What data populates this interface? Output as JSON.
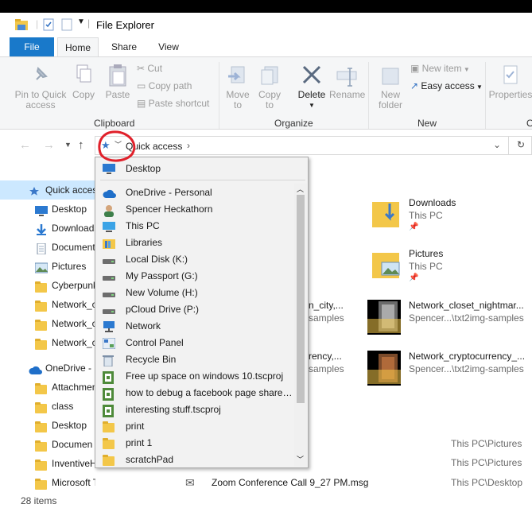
{
  "window": {
    "title": "File Explorer"
  },
  "tabs": [
    {
      "label": "File"
    },
    {
      "label": "Home"
    },
    {
      "label": "Share"
    },
    {
      "label": "View"
    }
  ],
  "ribbon": {
    "pin_quick_access": "Pin to Quick\naccess",
    "copy": "Copy",
    "paste": "Paste",
    "cut": "Cut",
    "copy_path": "Copy path",
    "paste_shortcut": "Paste shortcut",
    "clipboard_group": "Clipboard",
    "move_to": "Move\nto",
    "copy_to": "Copy\nto",
    "delete": "Delete",
    "rename": "Rename",
    "organize_group": "Organize",
    "new_folder": "New\nfolder",
    "new_item": "New item",
    "easy_access": "Easy access",
    "new_group": "New",
    "properties": "Properties",
    "open_group": "O"
  },
  "address": {
    "breadcrumb": "Quick access"
  },
  "nav_pane": [
    {
      "label": "Quick access",
      "icon": "star-icon"
    },
    {
      "label": "Desktop",
      "icon": "desktop-icon"
    },
    {
      "label": "Downloads",
      "icon": "download-icon"
    },
    {
      "label": "Documents",
      "icon": "documents-icon"
    },
    {
      "label": "Pictures",
      "icon": "pictures-icon"
    },
    {
      "label": "Cyberpunk",
      "icon": "folder-icon"
    },
    {
      "label": "Network_c",
      "icon": "folder-icon"
    },
    {
      "label": "Network_c",
      "icon": "folder-icon"
    },
    {
      "label": "Network_c",
      "icon": "folder-icon"
    },
    {
      "label": "OneDrive - I",
      "icon": "cloud-icon"
    },
    {
      "label": "Attachmen",
      "icon": "folder-icon"
    },
    {
      "label": "class",
      "icon": "folder-icon"
    },
    {
      "label": "Desktop",
      "icon": "folder-icon"
    },
    {
      "label": "Documen",
      "icon": "folder-icon"
    },
    {
      "label": "InventiveH",
      "icon": "folder-icon"
    },
    {
      "label": "Microsoft Teams Chat",
      "icon": "folder-icon"
    }
  ],
  "dropdown": {
    "top_item": "Desktop",
    "items": [
      {
        "label": "OneDrive - Personal",
        "icon": "cloud-icon"
      },
      {
        "label": "Spencer Heckathorn",
        "icon": "user-icon"
      },
      {
        "label": "This PC",
        "icon": "pc-icon"
      },
      {
        "label": "Libraries",
        "icon": "library-icon"
      },
      {
        "label": "Local Disk (K:)",
        "icon": "drive-icon"
      },
      {
        "label": "My Passport (G:)",
        "icon": "drive-icon"
      },
      {
        "label": "New Volume (H:)",
        "icon": "drive-icon"
      },
      {
        "label": "pCloud Drive (P:)",
        "icon": "drive-icon"
      },
      {
        "label": "Network",
        "icon": "network-icon"
      },
      {
        "label": "Control Panel",
        "icon": "control-panel-icon"
      },
      {
        "label": "Recycle Bin",
        "icon": "recycle-bin-icon"
      },
      {
        "label": "Free up space on windows 10.tscproj",
        "icon": "tscproj-icon"
      },
      {
        "label": "how to debug a facebook page share....",
        "icon": "tscproj-icon"
      },
      {
        "label": "interesting stuff.tscproj",
        "icon": "tscproj-icon"
      },
      {
        "label": "print",
        "icon": "folder-icon"
      },
      {
        "label": "print 1",
        "icon": "folder-icon"
      },
      {
        "label": "scratchPad",
        "icon": "folder-icon"
      }
    ]
  },
  "content": {
    "tiles": [
      {
        "name": "Downloads",
        "sub": "This PC"
      },
      {
        "name": "Pictures",
        "sub": "This PC"
      },
      {
        "name": "Network_closet_nightmar...",
        "sub": "Spencer...\\txt2img-samples"
      },
      {
        "name": "Network_cryptocurrency_...",
        "sub": "Spencer...\\txt2img-samples"
      }
    ],
    "partial_left": [
      {
        "name": "n_city,...",
        "sub": "samples"
      },
      {
        "name": "rency,...",
        "sub": "samples"
      }
    ],
    "recent": [
      {
        "location": "This PC\\Pictures"
      },
      {
        "location": "This PC\\Pictures"
      },
      {
        "name": "Zoom Conference Call 9_27 PM.msg",
        "location": "This PC\\Desktop"
      }
    ]
  },
  "status": {
    "items": "28 items"
  },
  "colors": {
    "accent": "#1979ca",
    "folder": "#f3c749",
    "annotation": "#e0202a"
  }
}
